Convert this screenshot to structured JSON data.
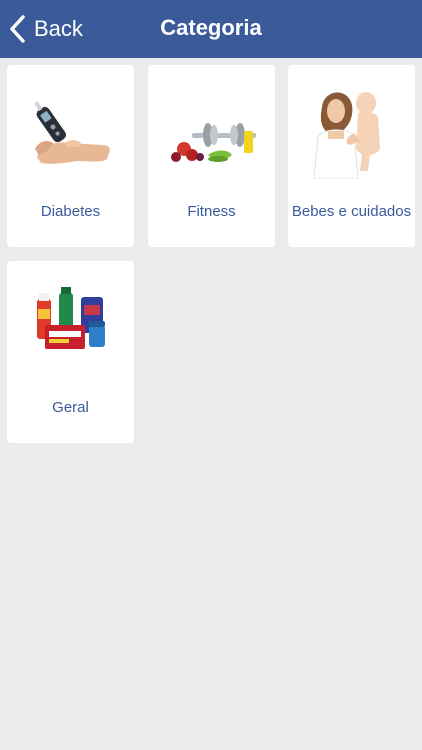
{
  "navbar": {
    "back_label": "Back",
    "title": "Categoria",
    "background": "#3a5a9a"
  },
  "categories": [
    {
      "label": "Diabetes",
      "icon": "glucose-meter-image"
    },
    {
      "label": "Fitness",
      "icon": "dumbbell-fruit-image"
    },
    {
      "label": "Bebes e cuidados",
      "icon": "mother-baby-image"
    },
    {
      "label": "Geral",
      "icon": "medicine-products-image"
    }
  ],
  "colors": {
    "background": "#ebebeb",
    "tile": "#ffffff",
    "label": "#3a5a9a"
  }
}
